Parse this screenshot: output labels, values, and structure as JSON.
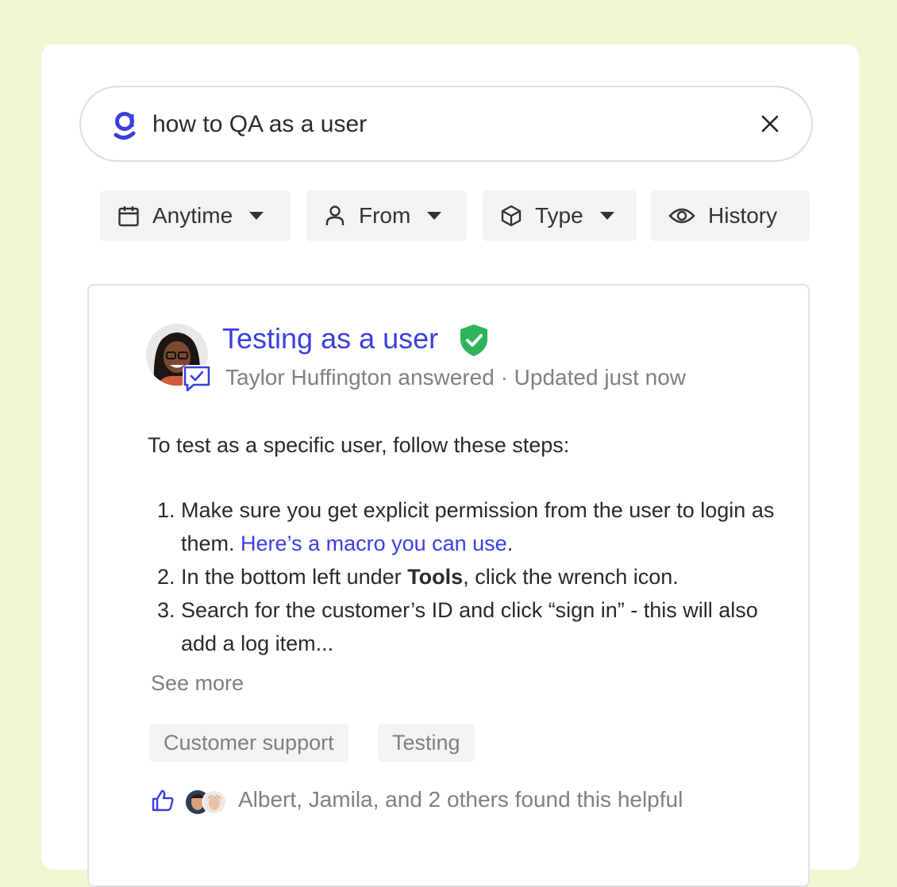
{
  "search": {
    "query": "how to QA as a user",
    "logo_icon": "glean-logo-icon",
    "clear_icon": "close-icon"
  },
  "filters": [
    {
      "label": "Anytime",
      "icon": "calendar-icon",
      "dropdown": true
    },
    {
      "label": "From",
      "icon": "person-icon",
      "dropdown": true
    },
    {
      "label": "Type",
      "icon": "cube-icon",
      "dropdown": true
    },
    {
      "label": "History",
      "icon": "eye-icon",
      "dropdown": false
    }
  ],
  "result": {
    "title": "Testing as a user",
    "verified_icon": "verified-shield-icon",
    "meta": "Taylor Huffington answered · Updated just now",
    "intro": "To test as a specific user, follow these steps:",
    "steps": [
      {
        "before": "Make sure you get explicit permission from the user to login as them. ",
        "link": "Here’s a macro you can use",
        "after": "."
      },
      {
        "before": "In the bottom left under ",
        "bold": "Tools",
        "after": ", click the wrench icon."
      },
      {
        "before": "Search for the customer’s ID and click “sign in” - this will also add a log item..."
      }
    ],
    "see_more": "See more",
    "tags": [
      "Customer support",
      "Testing"
    ],
    "helpful": "Albert, Jamila, and 2 others found this helpful"
  },
  "colors": {
    "background": "#eff6d2",
    "accent": "#3b3ee0",
    "verified": "#2fb45a",
    "muted_text": "#808080"
  }
}
